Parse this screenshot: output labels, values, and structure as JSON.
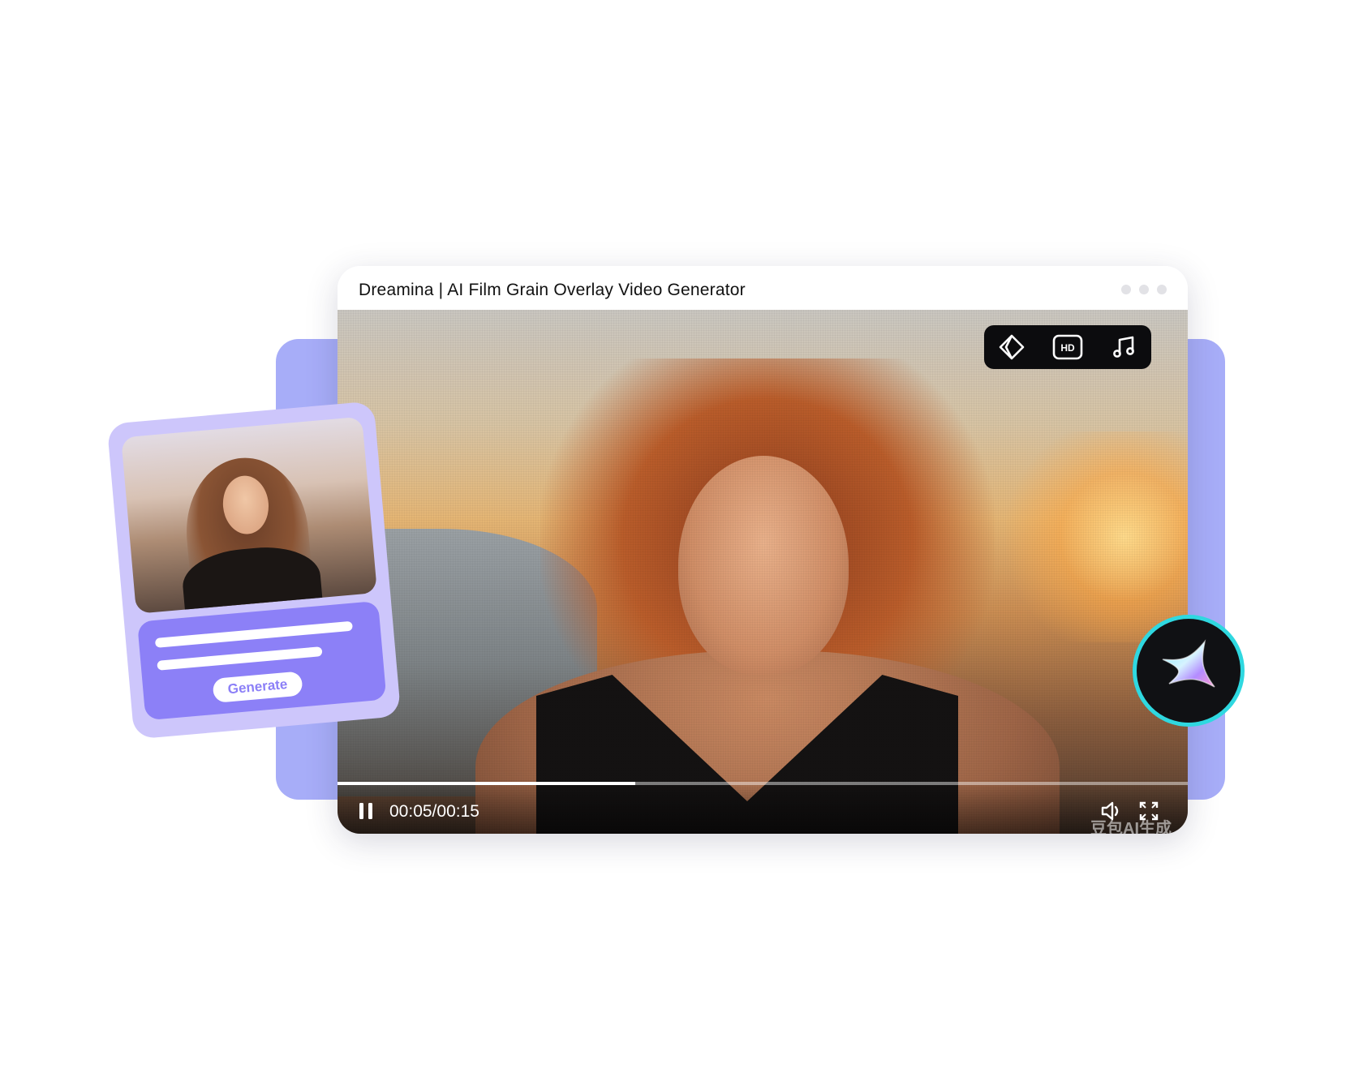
{
  "window": {
    "title": "Dreamina | AI Film Grain Overlay Video Generator"
  },
  "video": {
    "toolbar": {
      "tools": [
        "diamond-icon",
        "hd-icon",
        "music-note-icon"
      ],
      "hd_label": "HD"
    },
    "player": {
      "time": "00:05/00:15",
      "progress_fraction": 0.35,
      "watermark": "豆包AI生成"
    }
  },
  "card": {
    "generate_label": "Generate"
  },
  "colors": {
    "backplate": "#a7adf8",
    "card": "#cdc6fb",
    "card_panel": "#8c80f7",
    "badge_ring": "#2fd8e0"
  }
}
